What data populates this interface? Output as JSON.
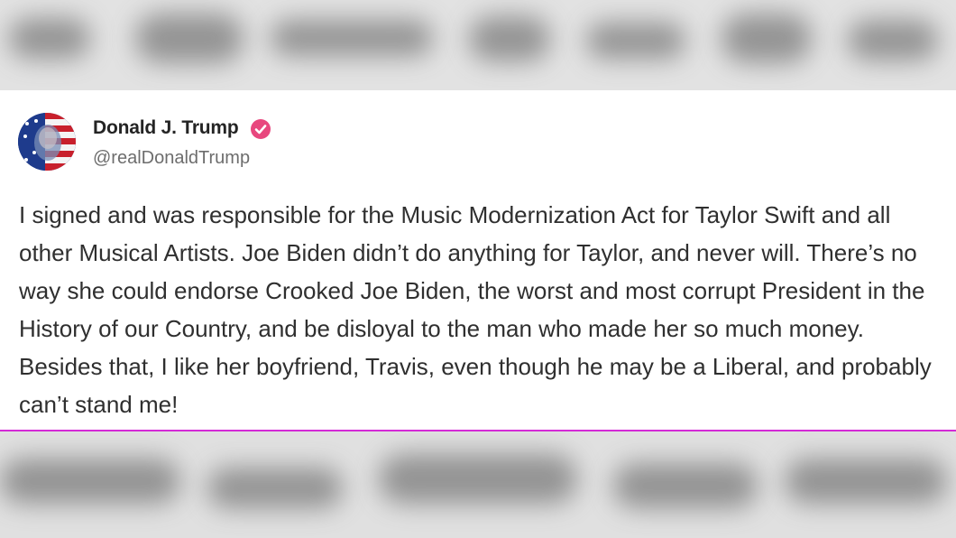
{
  "post": {
    "display_name": "Donald J. Trump",
    "handle": "@realDonaldTrump",
    "verified_color": "#e8477e",
    "body": "I signed and was responsible for the Music Modernization Act for Taylor Swift and all other Musical Artists. Joe Biden didn’t do anything for Taylor, and never will. There’s no way she could endorse Crooked Joe Biden, the worst and most corrupt President in the History of our Country, and be disloyal to the man who made her so much money. Besides that, I like her boyfriend, Travis, even though he may be a Liberal, and probably can’t stand me!"
  },
  "icons": {
    "avatar": "flag-portrait-avatar",
    "badge": "verified-badge-icon"
  },
  "colors": {
    "accent_line": "#d42ad6",
    "card_background": "#ffffff"
  }
}
